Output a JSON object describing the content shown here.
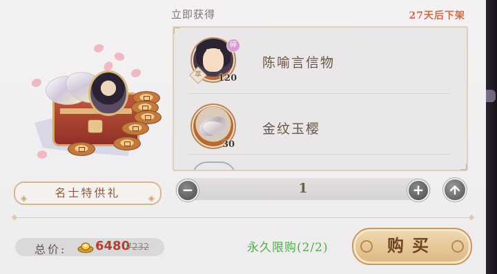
{
  "header": {
    "immediate_label": "立即获得",
    "expiry_label": "27天后下架"
  },
  "items": [
    {
      "name": "陈喻言信物",
      "count": "120",
      "icon": "character-token-icon",
      "rarity_badge": "萃",
      "fragment_badge": "碎"
    },
    {
      "name": "金纹玉樱",
      "count": "30",
      "icon": "jade-petal-icon"
    }
  ],
  "gift": {
    "name": "名士特供礼",
    "art": "gift-box-illustration"
  },
  "quantity": {
    "value": "1",
    "minus_icon": "minus-icon",
    "plus_icon": "plus-icon",
    "max_icon": "max-arrow-icon"
  },
  "price": {
    "label": "总价:",
    "currency_icon": "gold-ingot-icon",
    "value": "6480",
    "original": "7232"
  },
  "purchase": {
    "limit_text": "永久限购(2/2)",
    "buy_label": "购买"
  },
  "colors": {
    "accent_orange": "#cc6d4f",
    "price_red": "#b4412c",
    "limit_green": "#4caf47",
    "gold_border": "#c7985a"
  }
}
